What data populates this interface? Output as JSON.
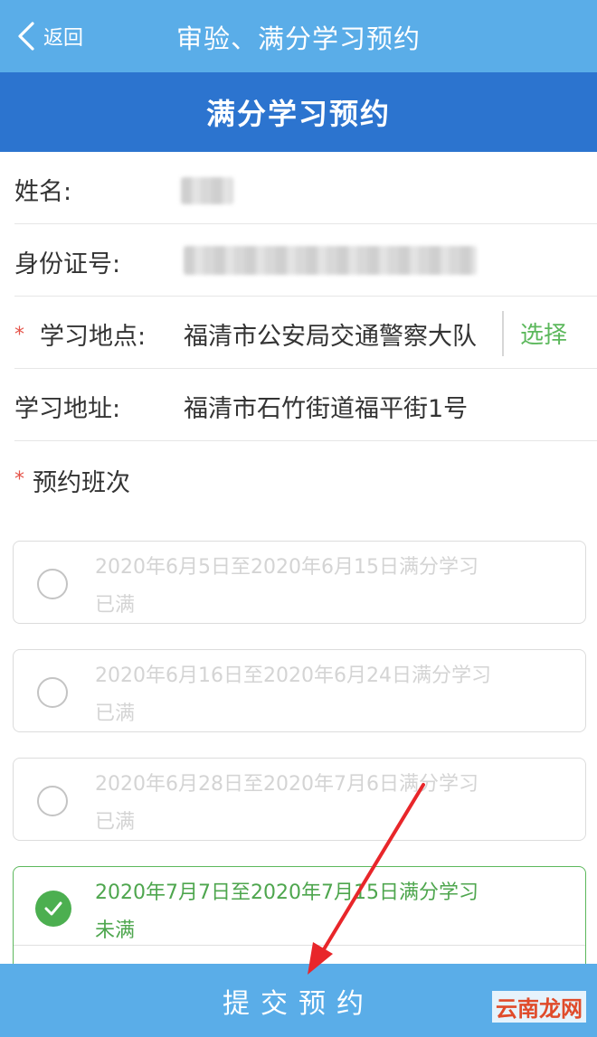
{
  "topbar": {
    "back_label": "返回",
    "title": "审验、满分学习预约"
  },
  "header": {
    "title": "满分学习预约"
  },
  "form": {
    "name_label": "姓名:",
    "id_label": "身份证号:",
    "study_place_label": "学习地点:",
    "study_place_value": "福清市公安局交通警察大队",
    "select_label": "选择",
    "address_label": "学习地址:",
    "address_value": "福清市石竹街道福平街1号",
    "class_label": "预约班次",
    "required_mark": "*"
  },
  "slots": [
    {
      "dates": "2020年6月5日至2020年6月15日满分学习",
      "status": "已满",
      "selected": false
    },
    {
      "dates": "2020年6月16日至2020年6月24日满分学习",
      "status": "已满",
      "selected": false
    },
    {
      "dates": "2020年6月28日至2020年7月6日满分学习",
      "status": "已满",
      "selected": false
    },
    {
      "dates": "2020年7月7日至2020年7月15日满分学习",
      "status": "未满",
      "selected": true
    }
  ],
  "submit": {
    "label": "提交预约"
  },
  "watermark": {
    "text": "云南龙网"
  },
  "colors": {
    "topbar": "#5aade8",
    "header": "#2c74cf",
    "accent_green": "#4caf50",
    "required_red": "#e5544a",
    "annotation_arrow": "#e8262a"
  }
}
